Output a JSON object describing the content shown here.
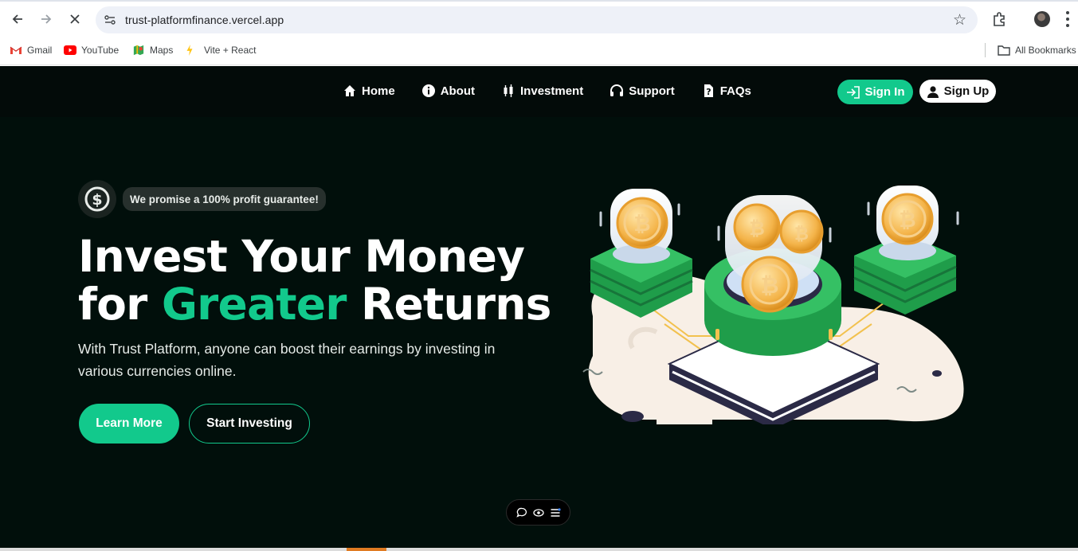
{
  "browser": {
    "url": "trust-platformfinance.vercel.app",
    "bookmarks": [
      {
        "label": "Gmail",
        "icon": "gmail-icon"
      },
      {
        "label": "YouTube",
        "icon": "youtube-icon"
      },
      {
        "label": "Maps",
        "icon": "maps-icon"
      },
      {
        "label": "Vite + React",
        "icon": "vite-icon"
      }
    ],
    "all_bookmarks": "All Bookmarks"
  },
  "nav": {
    "links": [
      {
        "label": "Home",
        "icon": "home-icon"
      },
      {
        "label": "About",
        "icon": "info-icon"
      },
      {
        "label": "Investment",
        "icon": "candlestick-icon"
      },
      {
        "label": "Support",
        "icon": "headset-icon"
      },
      {
        "label": "FAQs",
        "icon": "question-icon"
      }
    ],
    "sign_in": "Sign In",
    "sign_up": "Sign Up"
  },
  "hero": {
    "badge": "We promise a 100% profit guarantee!",
    "headline_line1": "Invest Your Money",
    "headline_for": "for",
    "headline_accent": "Greater",
    "headline_end": "Returns",
    "subtext": "With Trust Platform, anyone can boost their earnings by investing in various currencies online.",
    "learn_more": "Learn More",
    "start_investing": "Start Investing"
  },
  "colors": {
    "accent": "#12c98c",
    "background": "#010f0b",
    "navbar": "#030b09"
  }
}
